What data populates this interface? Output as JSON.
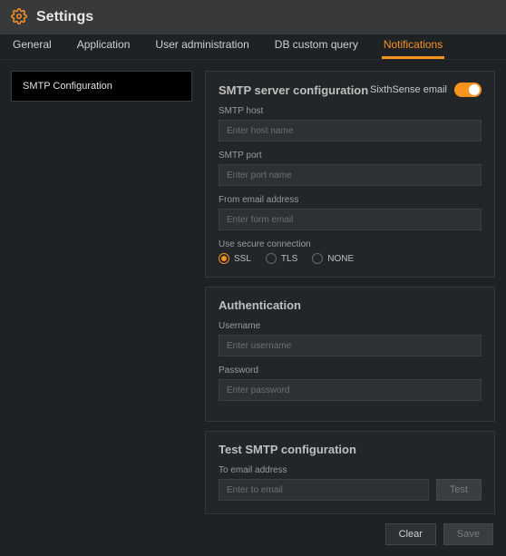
{
  "header": {
    "title": "Settings"
  },
  "tabs": {
    "general": "General",
    "application": "Application",
    "user_admin": "User administration",
    "db_custom": "DB custom query",
    "notifications": "Notifications"
  },
  "sidebar": {
    "smtp_config": "SMTP Configuration"
  },
  "smtp_panel": {
    "title": "SMTP server configuration",
    "toggle_label": "SixthSense email",
    "host_label": "SMTP host",
    "host_placeholder": "Enter host name",
    "port_label": "SMTP port",
    "port_placeholder": "Enter port name",
    "from_label": "From email address",
    "from_placeholder": "Enter form email",
    "secure_label": "Use secure connection",
    "opt_ssl": "SSL",
    "opt_tls": "TLS",
    "opt_none": "NONE"
  },
  "auth_panel": {
    "title": "Authentication",
    "user_label": "Username",
    "user_placeholder": "Enter username",
    "pass_label": "Password",
    "pass_placeholder": "Enter password"
  },
  "test_panel": {
    "title": "Test SMTP configuration",
    "to_label": "To email address",
    "to_placeholder": "Enter to email",
    "test_btn": "Test"
  },
  "footer": {
    "clear": "Clear",
    "save": "Save"
  }
}
